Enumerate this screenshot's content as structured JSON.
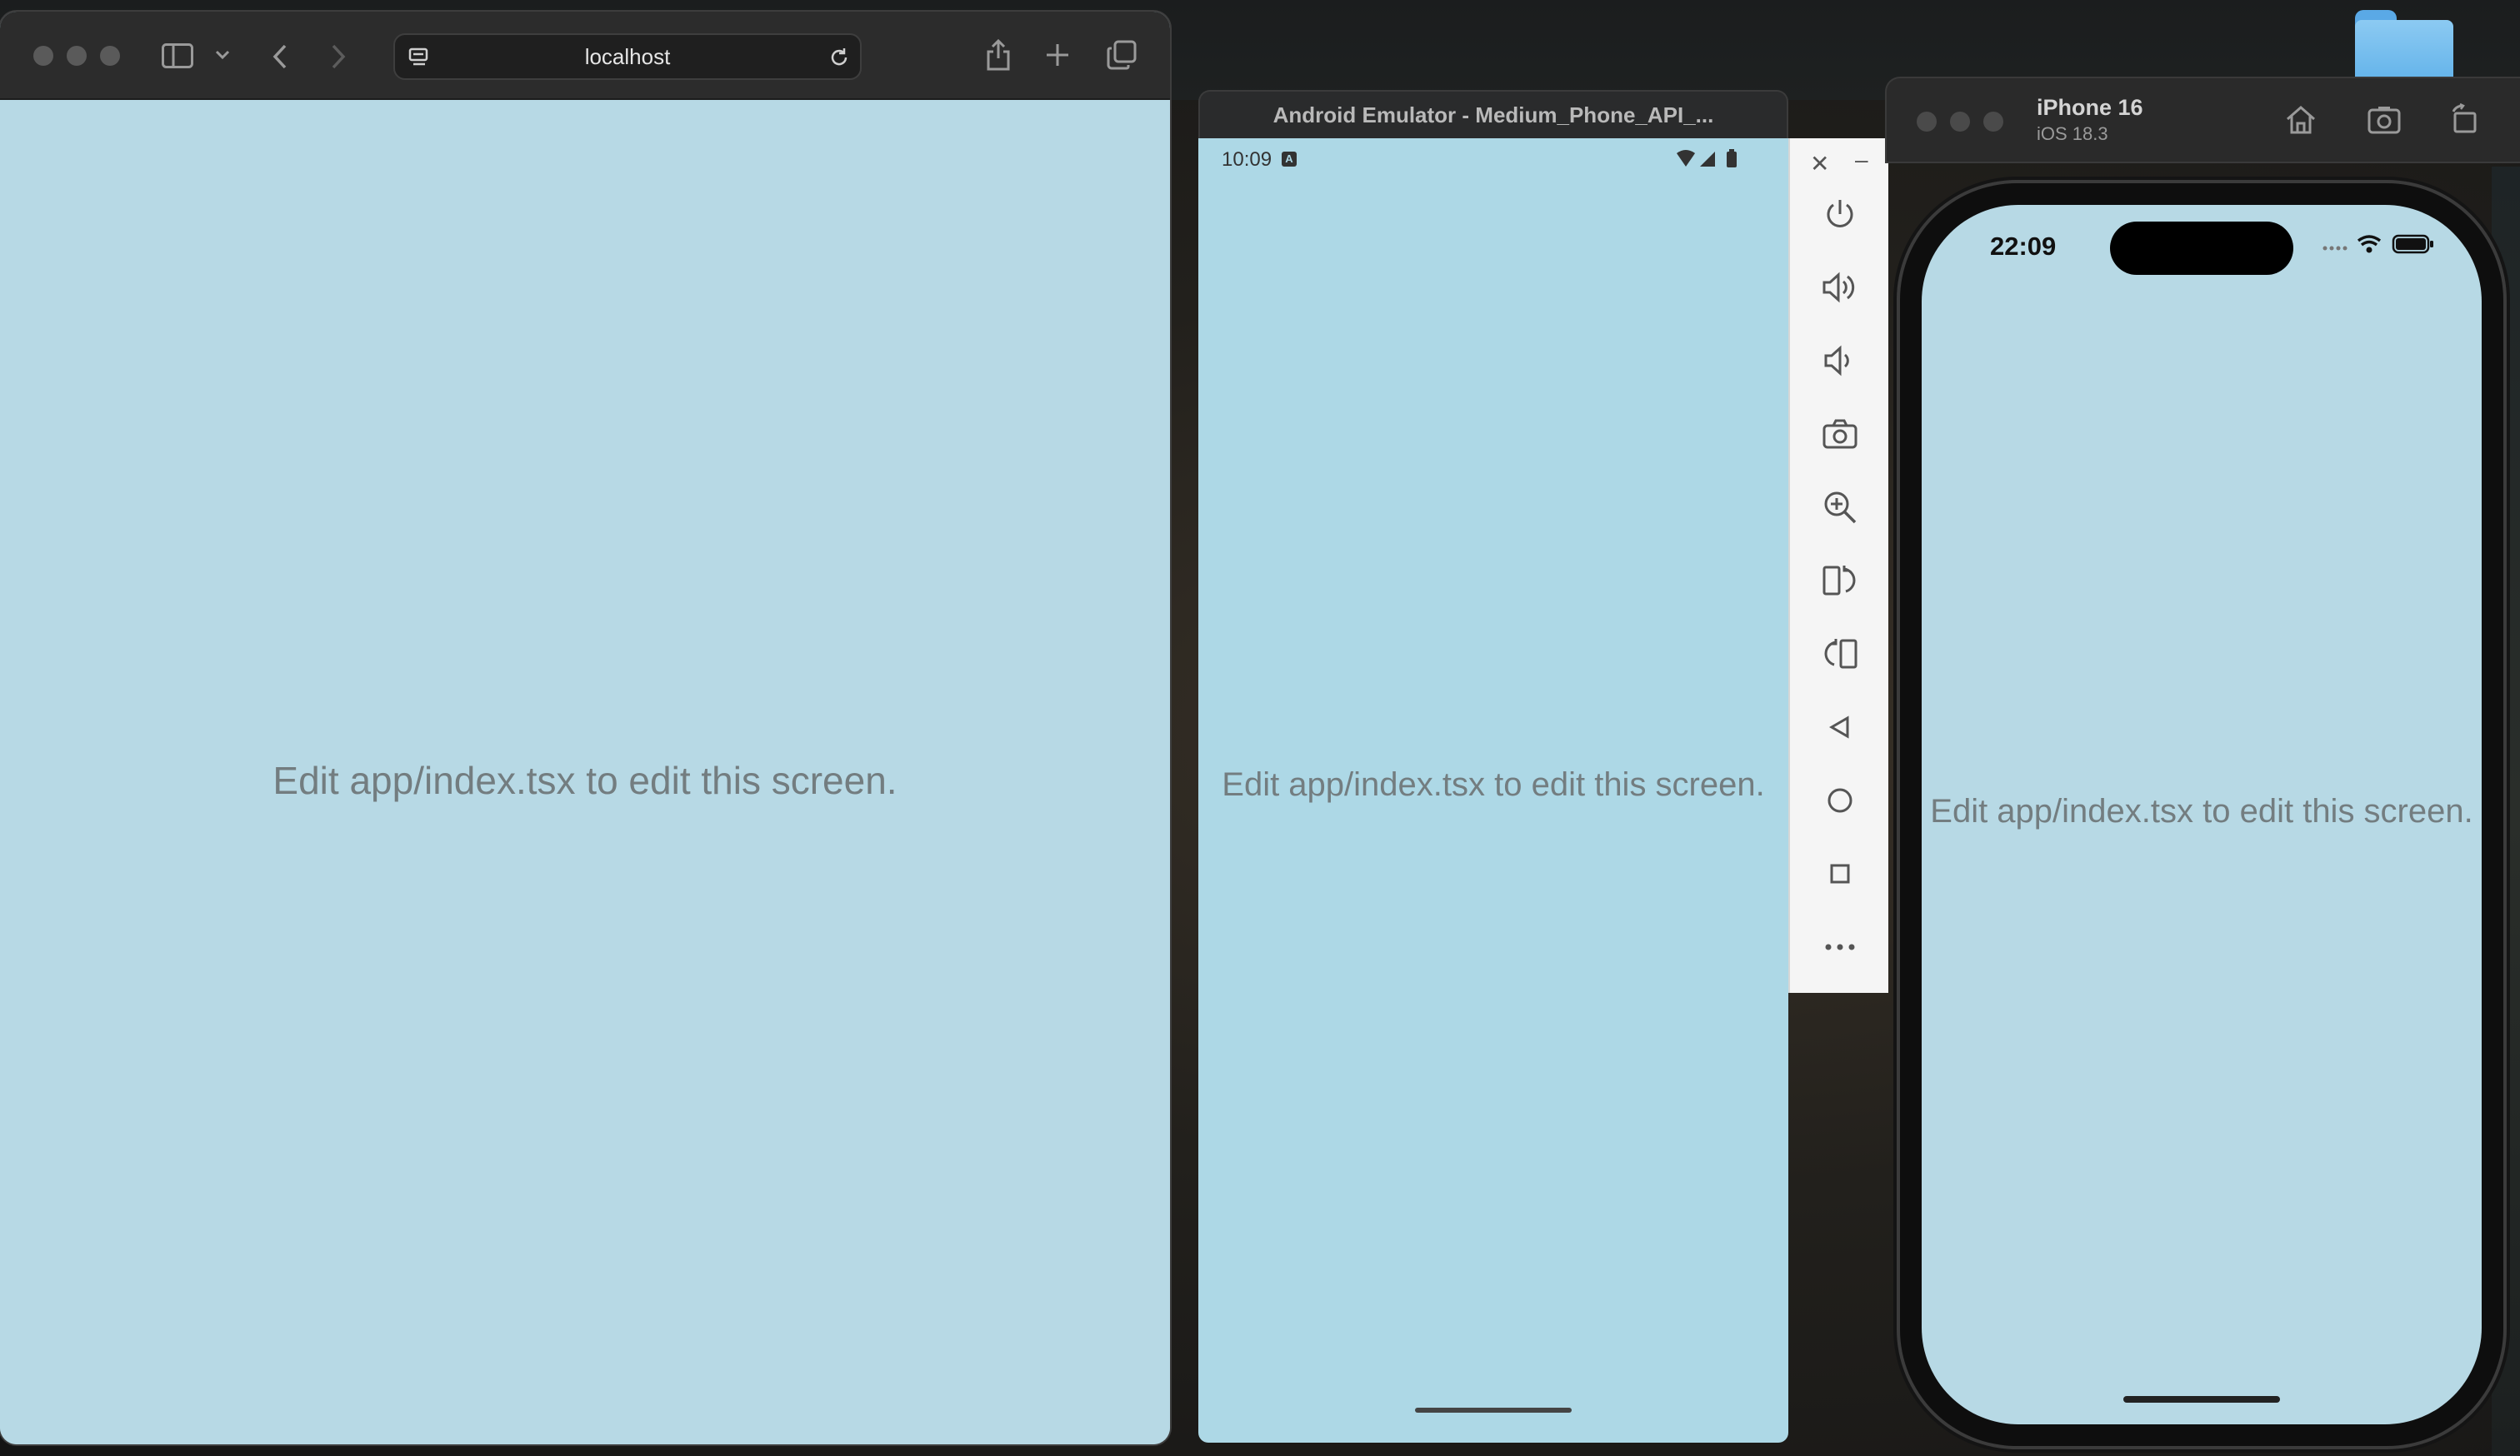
{
  "safari": {
    "url": "localhost",
    "content_text": "Edit app/index.tsx to edit this screen."
  },
  "android_emulator": {
    "window_title": "Android Emulator - Medium_Phone_API_...",
    "status_time": "10:09",
    "content_text": "Edit app/index.tsx to edit this screen.",
    "toolbar_controls": [
      "power",
      "volume-up",
      "volume-down",
      "screenshot",
      "zoom",
      "rotate-left",
      "rotate-right",
      "back",
      "home",
      "overview",
      "more"
    ]
  },
  "ios_simulator": {
    "device_name": "iPhone 16",
    "os_version": "iOS 18.3",
    "status_time": "22:09",
    "content_text": "Edit app/index.tsx to edit this screen."
  },
  "colors": {
    "app_background": "#add8e6",
    "hint_text": "#737d80",
    "window_chrome": "#2c2c2c"
  }
}
